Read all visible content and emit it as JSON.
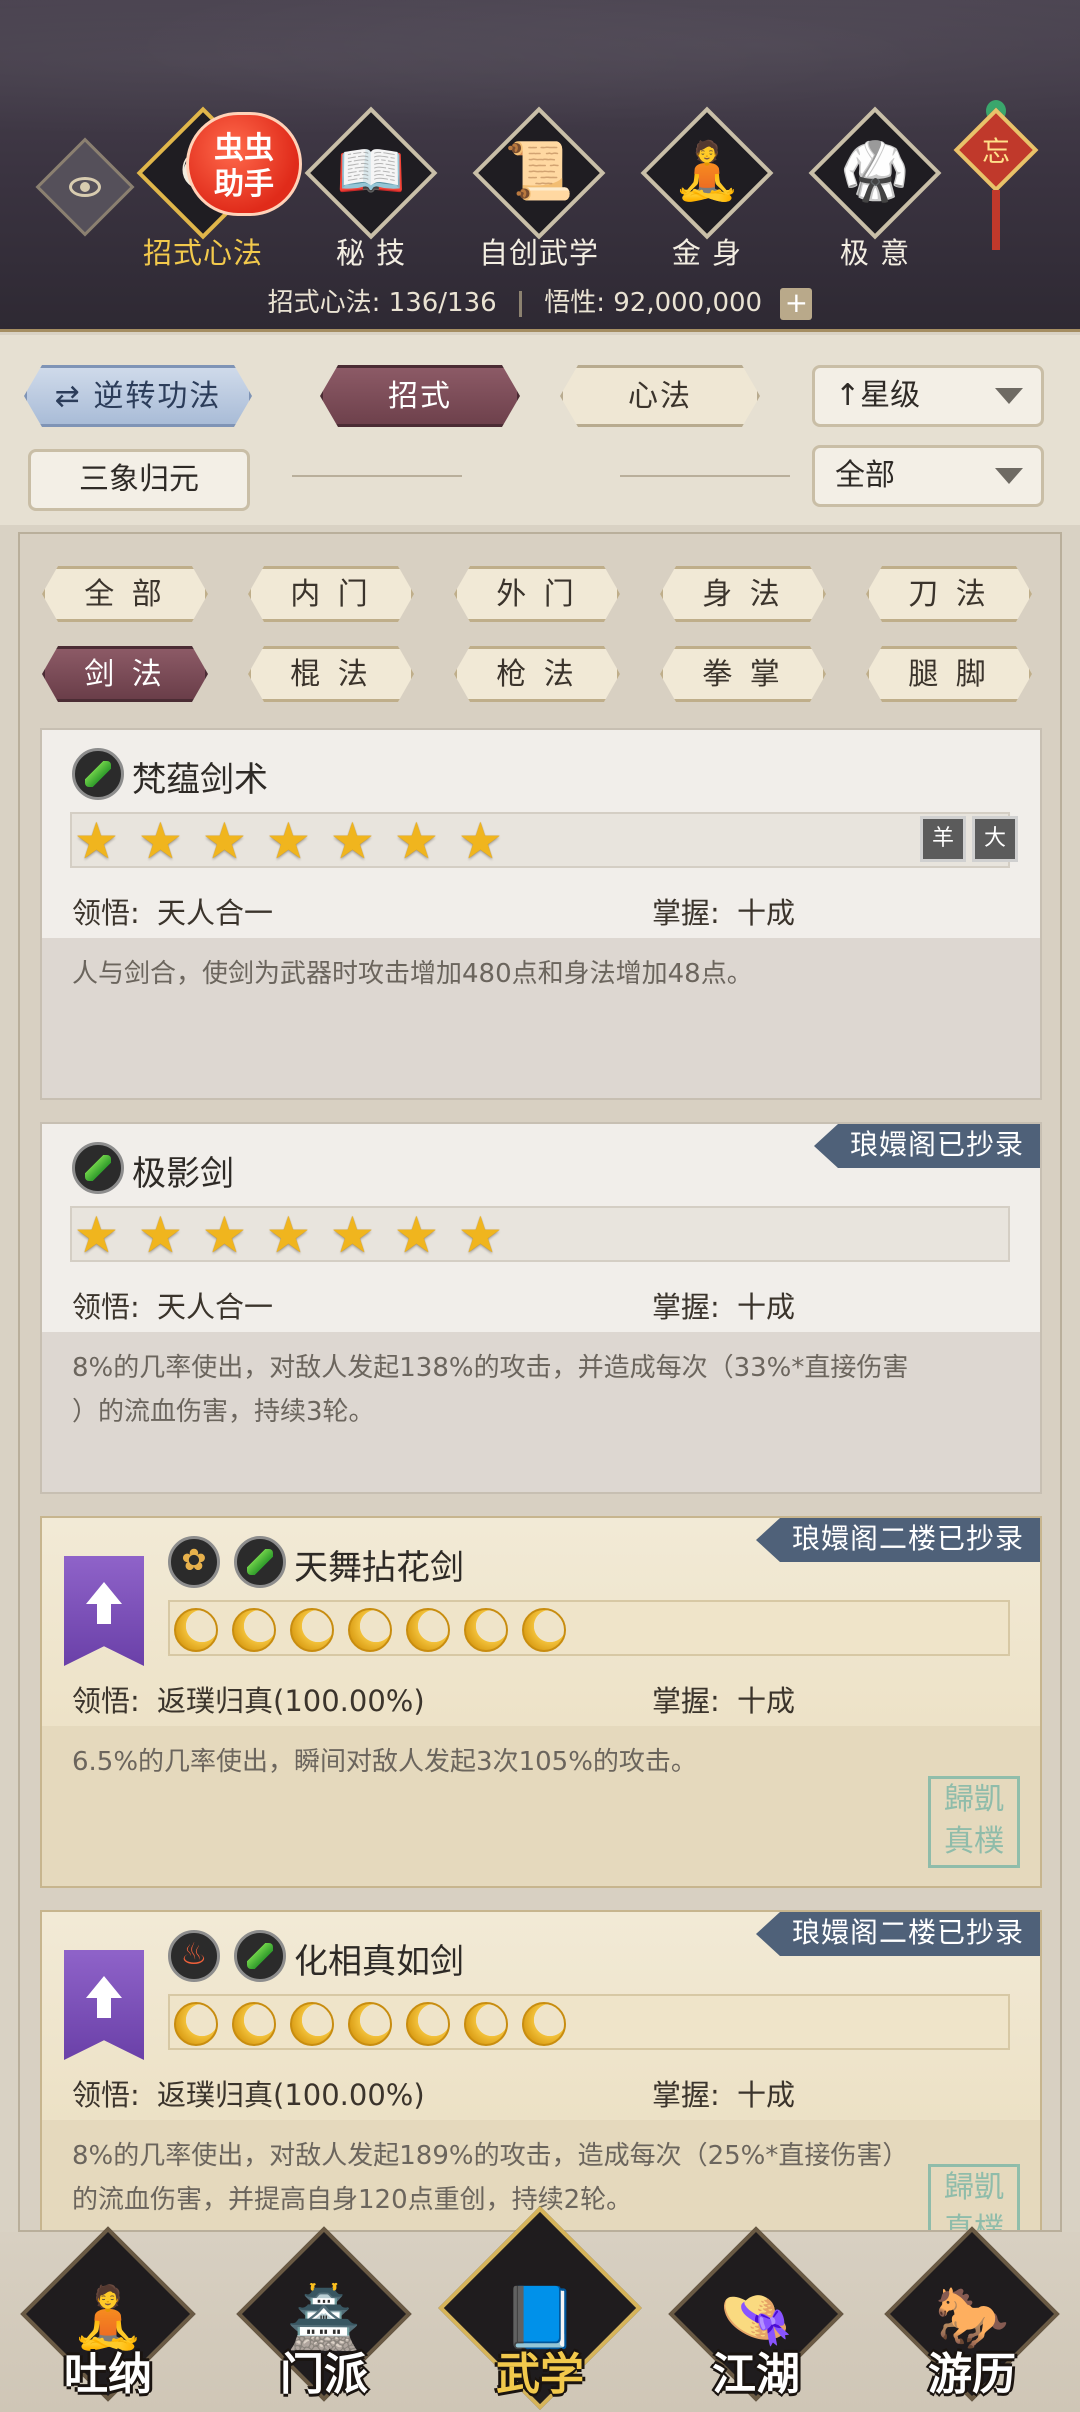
{
  "header": {
    "badge_text": "虫虫\n助手",
    "tabs": [
      {
        "label": "招式心法",
        "glyph": "☯",
        "icon": "scroll-glyph-icon"
      },
      {
        "label": "秘 技",
        "glyph": "📖",
        "icon": "book-icon"
      },
      {
        "label": "自创武学",
        "glyph": "📜",
        "icon": "scroll-icon"
      },
      {
        "label": "金 身",
        "glyph": "🧘",
        "icon": "meditation-icon"
      },
      {
        "label": "极 意",
        "glyph": "🥋",
        "icon": "martial-stance-icon"
      }
    ],
    "knot_char": "忘",
    "stats": {
      "moves_label": "招式心法:",
      "moves_value": "136/136",
      "insight_label": "悟性:",
      "insight_value": "92,000,000"
    }
  },
  "filters": {
    "reverse_label": "逆转功法",
    "tab_moves": "招式",
    "tab_mind": "心法",
    "sort_label": "星级",
    "sanxiang_label": "三象归元",
    "filter_all": "全部"
  },
  "categories": {
    "row1": [
      "全 部",
      "内 门",
      "外 门",
      "身 法",
      "刀 法"
    ],
    "row2": [
      "剑 法",
      "棍 法",
      "枪 法",
      "拳 掌",
      "腿 脚"
    ]
  },
  "cards": [
    {
      "name": "梵蕴剑术",
      "star_count": 7,
      "insight_label": "领悟:",
      "insight_value": "天人合一",
      "mastery_label": "掌握:",
      "mastery_value": "十成",
      "desc": "人与剑合，使剑为武器时攻击增加480点和身法增加48点。",
      "mini_icons": [
        "羊",
        "大"
      ]
    },
    {
      "name": "极影剑",
      "ribbon": "琅嬛阁已抄录",
      "star_count": 7,
      "insight_label": "领悟:",
      "insight_value": "天人合一",
      "mastery_label": "掌握:",
      "mastery_value": "十成",
      "desc1": "8%的几率使出，对敌人发起138%的攻击，并造成每次（33%*直接伤害",
      "desc2": "）的流血伤害，持续3轮。"
    },
    {
      "name": "天舞拈花剑",
      "ribbon": "琅嬛阁二楼已抄录",
      "moon_count": 7,
      "insight_label": "领悟:",
      "insight_value": "返璞归真(100.00%)",
      "mastery_label": "掌握:",
      "mastery_value": "十成",
      "desc": "6.5%的几率使出，瞬间对敌人发起3次105%的攻击。",
      "seal": "歸凱\n真樸"
    },
    {
      "name": "化相真如剑",
      "ribbon": "琅嬛阁二楼已抄录",
      "moon_count": 7,
      "insight_label": "领悟:",
      "insight_value": "返璞归真(100.00%)",
      "mastery_label": "掌握:",
      "mastery_value": "十成",
      "desc1": "8%的几率使出，对敌人发起189%的攻击，造成每次（25%*直接伤害）",
      "desc2": "的流血伤害，并提高自身120点重创，持续2轮。",
      "seal": "歸凱\n真樸"
    }
  ],
  "bottom_nav": [
    {
      "label": "吐纳",
      "glyph": "🧘",
      "icon": "monk-icon"
    },
    {
      "label": "门派",
      "glyph": "🏯",
      "icon": "sect-banner-icon"
    },
    {
      "label": "武学",
      "glyph": "📘",
      "icon": "martial-book-icon"
    },
    {
      "label": "江湖",
      "glyph": "👒",
      "icon": "straw-hat-icon"
    },
    {
      "label": "游历",
      "glyph": "🐎",
      "icon": "horse-icon"
    }
  ],
  "colors": {
    "accent_gold": "#f2c94c",
    "selected_tab": "#6e414c",
    "ribbon_blue": "#4f6179",
    "star_gold": "#f0b51e"
  }
}
